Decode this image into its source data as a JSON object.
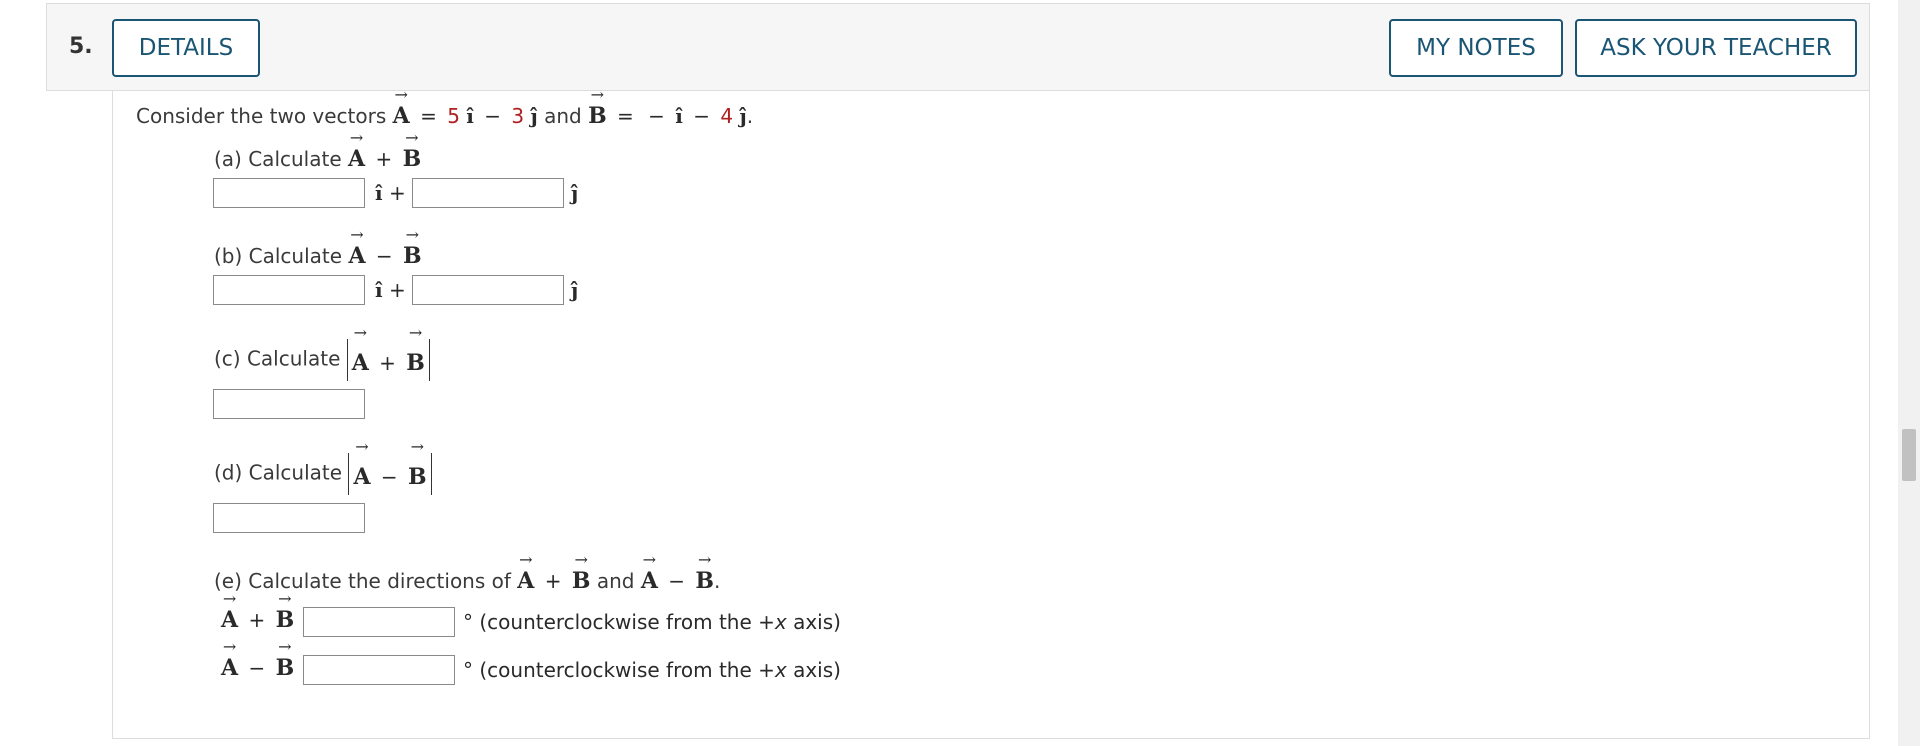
{
  "question": {
    "number": "5.",
    "buttons": {
      "details": "DETAILS",
      "my_notes": "MY NOTES",
      "ask_teacher": "ASK YOUR TEACHER"
    }
  },
  "problem": {
    "intro": {
      "prefix": "Consider the two vectors",
      "vec_a": "A",
      "equals": "=",
      "a_x": "5",
      "i_hat": "î",
      "minus": "−",
      "a_y": "3",
      "j_hat": "ĵ",
      "and": "and",
      "vec_b": "B",
      "b_neg": "−",
      "b_y": "4",
      "period": "."
    },
    "parts": {
      "a": {
        "label": "(a) Calculate",
        "operator": "+"
      },
      "b": {
        "label": "(b) Calculate",
        "operator": "−"
      },
      "c": {
        "label": "(c) Calculate",
        "operator": "+"
      },
      "d": {
        "label": "(d) Calculate",
        "operator": "−"
      },
      "e": {
        "label": "(e) Calculate the directions of",
        "and": "and",
        "period": ".",
        "unit_text_prefix": "° (counterclockwise from the ",
        "unit_text_axis": "+x",
        "unit_text_suffix": " axis)"
      }
    },
    "symbols": {
      "arrow": "→",
      "i_hat": "î",
      "j_hat": "ĵ",
      "plus": "+"
    },
    "inputs": {
      "a_i": "",
      "a_j": "",
      "b_i": "",
      "b_j": "",
      "c": "",
      "d": "",
      "e_sum": "",
      "e_diff": ""
    }
  }
}
